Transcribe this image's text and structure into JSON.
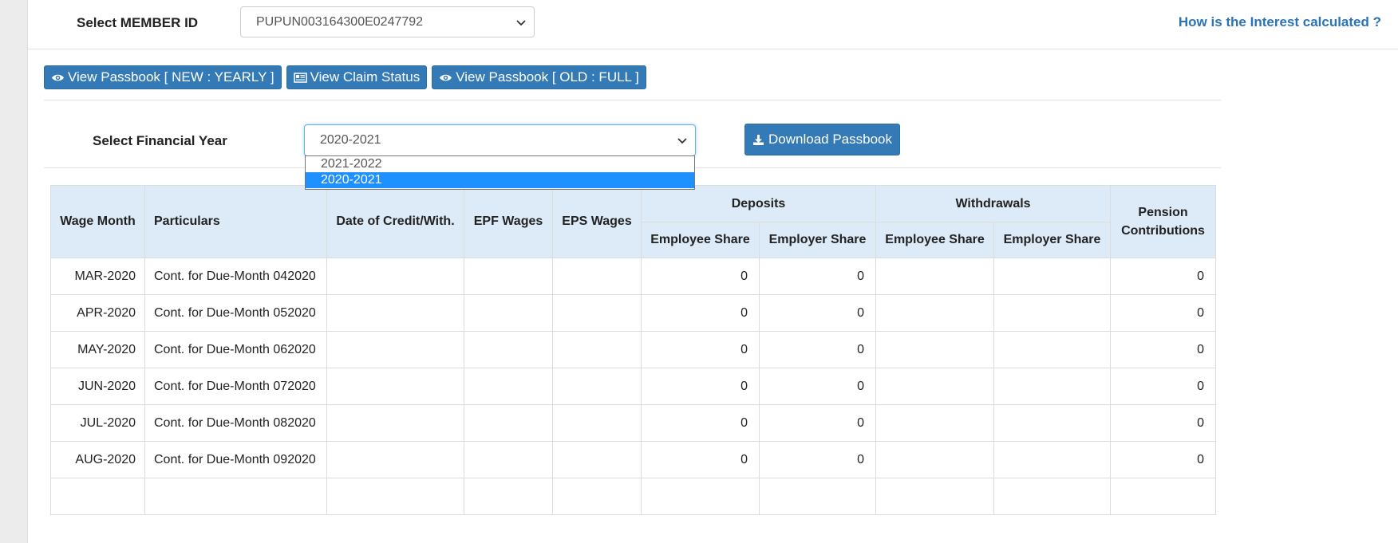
{
  "member": {
    "label": "Select MEMBER ID",
    "selected": "PUPUN003164300E0247792"
  },
  "interest_link": "How is the Interest calculated ?",
  "buttons": {
    "passbook_new": "View Passbook [ NEW : YEARLY ]",
    "claim_status": "View Claim Status",
    "passbook_old": "View Passbook [ OLD : FULL ]"
  },
  "year": {
    "label": "Select Financial Year",
    "selected": "2020-2021",
    "options": [
      "2021-2022",
      "2020-2021"
    ]
  },
  "download_label": "Download Passbook",
  "table": {
    "headers": {
      "wage_month": "Wage Month",
      "particulars": "Particulars",
      "date_credit": "Date of Credit/With.",
      "epf_wages": "EPF Wages",
      "eps_wages": "EPS Wages",
      "deposits": "Deposits",
      "withdrawals": "Withdrawals",
      "pension": "Pension Contributions",
      "employee_share": "Employee Share",
      "employer_share": "Employer Share"
    },
    "rows": [
      {
        "month": "MAR-2020",
        "particulars": "Cont. for Due-Month 042020",
        "dep_emp": "0",
        "dep_er": "0",
        "pension": "0"
      },
      {
        "month": "APR-2020",
        "particulars": "Cont. for Due-Month 052020",
        "dep_emp": "0",
        "dep_er": "0",
        "pension": "0"
      },
      {
        "month": "MAY-2020",
        "particulars": "Cont. for Due-Month 062020",
        "dep_emp": "0",
        "dep_er": "0",
        "pension": "0"
      },
      {
        "month": "JUN-2020",
        "particulars": "Cont. for Due-Month 072020",
        "dep_emp": "0",
        "dep_er": "0",
        "pension": "0"
      },
      {
        "month": "JUL-2020",
        "particulars": "Cont. for Due-Month 082020",
        "dep_emp": "0",
        "dep_er": "0",
        "pension": "0"
      },
      {
        "month": "AUG-2020",
        "particulars": "Cont. for Due-Month 092020",
        "dep_emp": "0",
        "dep_er": "0",
        "pension": "0"
      }
    ]
  },
  "colors": {
    "primary": "#337ab7",
    "link": "#2a73b8",
    "header_bg": "#ddeaf7",
    "selected_option": "#1e90ff"
  }
}
